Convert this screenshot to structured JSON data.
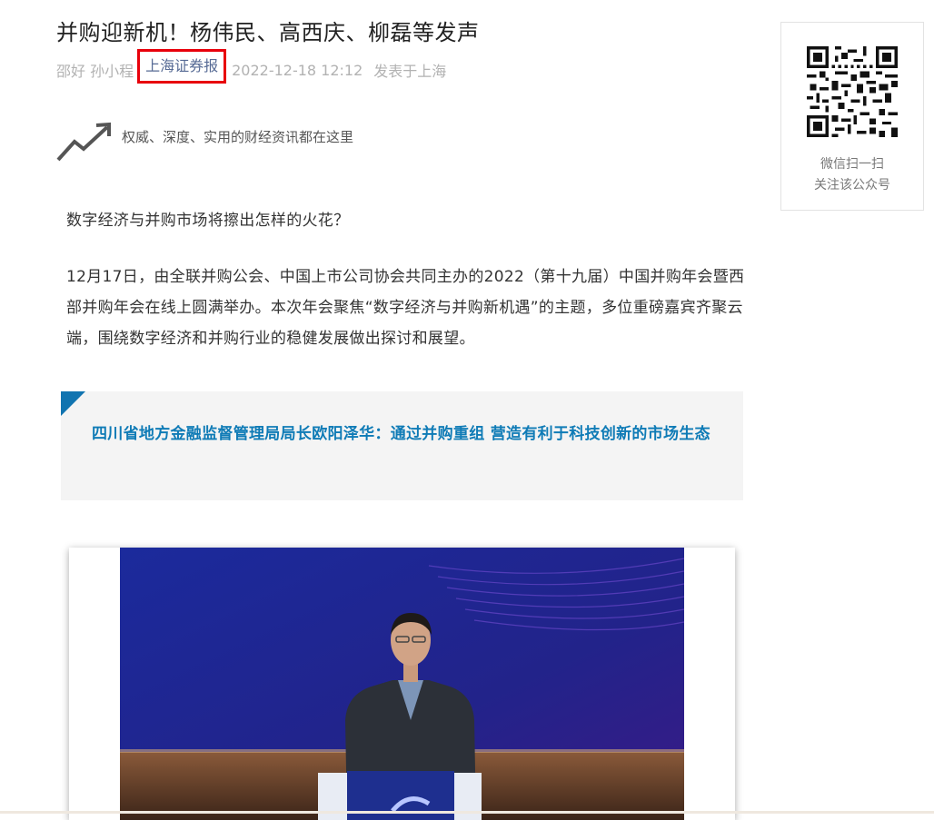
{
  "article": {
    "title": "并购迎新机！杨伟民、高西庆、柳磊等发声",
    "meta": {
      "authors": "邵好 孙小程",
      "account": "上海证券报",
      "date": "2022-12-18 12:12",
      "location": "发表于上海"
    },
    "slogan": "权威、深度、实用的财经资讯都在这里",
    "paragraphs": [
      "数字经济与并购市场将擦出怎样的火花？",
      "12月17日，由全联并购公会、中国上市公司协会共同主办的2022（第十九届）中国并购年会暨西部并购年会在线上圆满举办。本次年会聚焦“数字经济与并购新机遇”的主题，多位重磅嘉宾齐聚云端，围绕数字经济和并购行业的稳健发展做出探讨和展望。"
    ],
    "callout": "四川省地方金融监督管理局局长欧阳泽华：通过并购重组 营造有利于科技创新的市场生态"
  },
  "sidebar": {
    "qr_caption_line1": "微信扫一扫",
    "qr_caption_line2": "关注该公众号"
  },
  "colors": {
    "account_link": "#576b95",
    "highlight_box": "#e8000b",
    "callout_text": "#0f7bb6",
    "callout_corner": "#1174b0",
    "meta_gray": "#b2b2b2"
  }
}
